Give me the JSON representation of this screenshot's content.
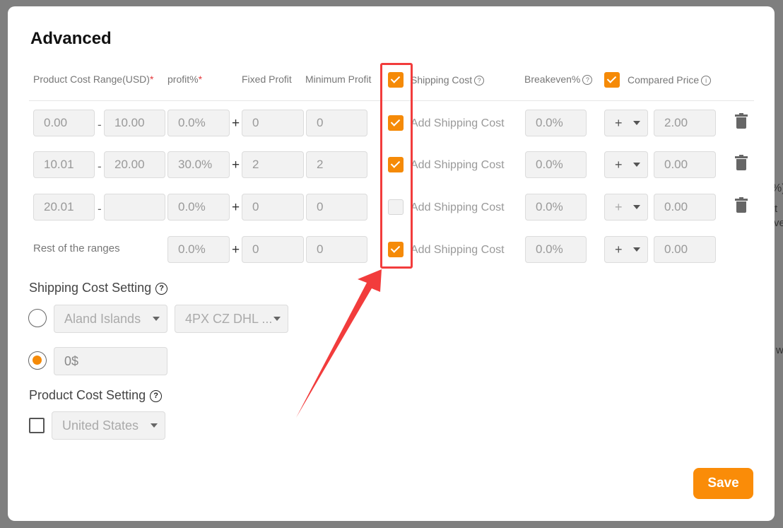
{
  "background": {
    "fragment_1": "%)",
    "fragment_2": "t",
    "fragment_3": "ve",
    "fragment_4": "w"
  },
  "modal": {
    "title": "Advanced",
    "headers": {
      "cost_range": "Product Cost Range(USD)",
      "cost_range_req": "*",
      "profit": "profit%",
      "profit_req": "*",
      "fixed_profit": "Fixed Profit",
      "minimum_profit": "Minimum Profit",
      "shipping_cost": "Shipping Cost",
      "breakeven": "Breakeven%",
      "compared_price": "Compared Price",
      "help_glyph": "?",
      "info_glyph": "i",
      "shipping_header_checked": true,
      "compared_price_checked": true
    },
    "rows": [
      {
        "from": "0.00",
        "to": "10.00",
        "profit": "0.0%",
        "fixed": "0",
        "minimum": "0",
        "shipping_checked": true,
        "shipping_label": "Add Shipping Cost",
        "breakeven": "0.0%",
        "operator": "+",
        "compared": "2.00"
      },
      {
        "from": "10.01",
        "to": "20.00",
        "profit": "30.0%",
        "fixed": "2",
        "minimum": "2",
        "shipping_checked": true,
        "shipping_label": "Add Shipping Cost",
        "breakeven": "0.0%",
        "operator": "+",
        "compared": "0.00"
      },
      {
        "from": "20.01",
        "to": "",
        "profit": "0.0%",
        "fixed": "0",
        "minimum": "0",
        "shipping_checked": false,
        "shipping_label": "Add Shipping Cost",
        "breakeven": "0.0%",
        "operator": "+",
        "compared": "0.00"
      }
    ],
    "rest_row": {
      "label": "Rest of the ranges",
      "profit": "0.0%",
      "fixed": "0",
      "minimum": "0",
      "shipping_checked": true,
      "shipping_label": "Add Shipping Cost",
      "breakeven": "0.0%",
      "operator": "+",
      "compared": "0.00"
    },
    "dash": "-",
    "plus": "+",
    "shipping_setting": {
      "title": "Shipping Cost Setting",
      "country": "Aland Islands",
      "method": "4PX CZ DHL ...",
      "fixed_value": "0$",
      "selected": "fixed"
    },
    "product_setting": {
      "title": "Product Cost Setting",
      "country": "United States",
      "checked": false
    },
    "save_label": "Save"
  },
  "colors": {
    "accent": "#fa8c08",
    "annotation": "#f23c3c"
  }
}
